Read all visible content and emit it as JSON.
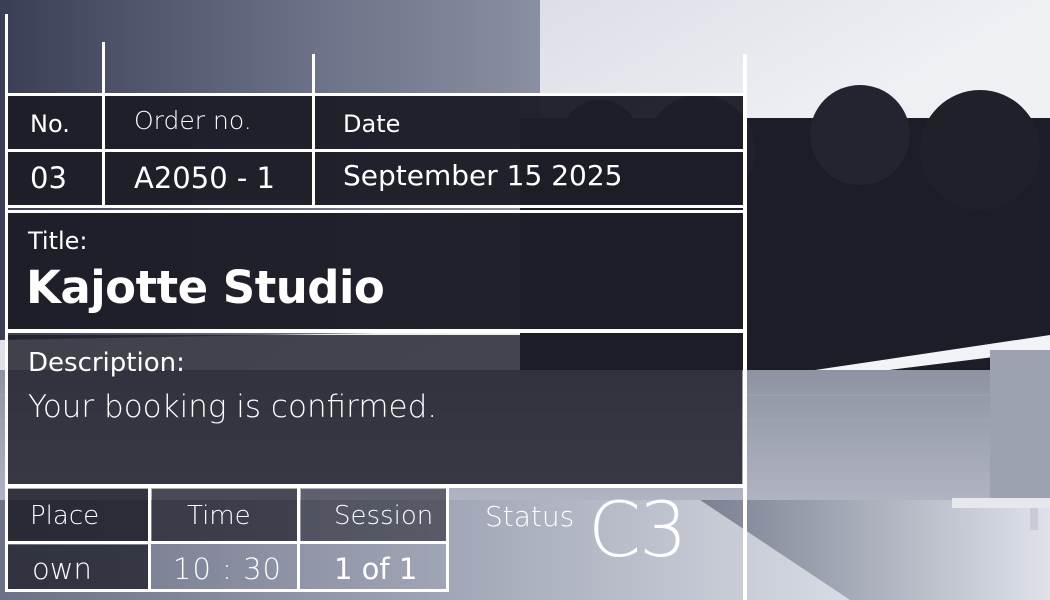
{
  "ticket": {
    "headers": {
      "no": "No.",
      "order": "Order no.",
      "date": "Date"
    },
    "values": {
      "no": "03",
      "order": "A2050 - 1",
      "date": "September 15 2025"
    },
    "title_label": "Title:",
    "title": "Kajotte Studio",
    "description_label": "Description:",
    "description": "Your booking is confirmed.",
    "bottom_headers": {
      "place": "Place",
      "time": "Time",
      "session": "Session",
      "status": "Status"
    },
    "bottom_values": {
      "place": "own",
      "time": "10 : 30",
      "session": "1 of 1",
      "status": "C3"
    }
  },
  "colors": {
    "panel": "#1d1d28",
    "sky": "#eef0f4",
    "wall": "#9aa0ae",
    "line": "#ffffff"
  }
}
